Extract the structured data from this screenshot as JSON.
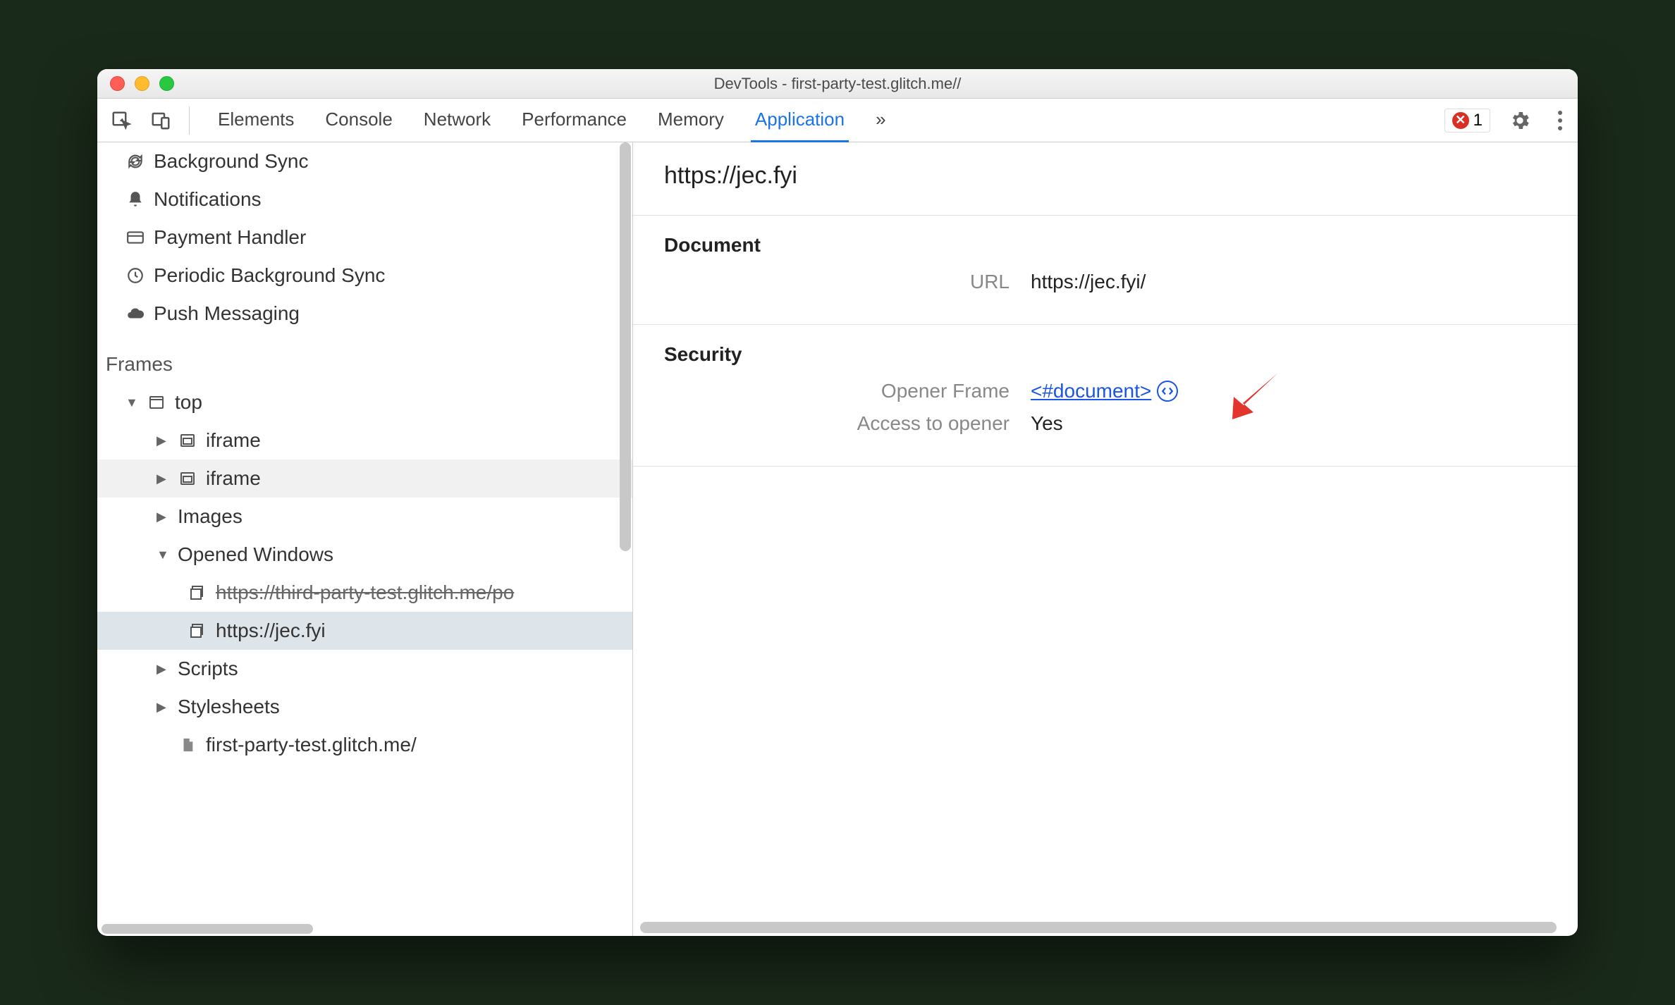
{
  "window": {
    "title": "DevTools - first-party-test.glitch.me//"
  },
  "toolbar": {
    "tabs": [
      "Elements",
      "Console",
      "Network",
      "Performance",
      "Memory",
      "Application"
    ],
    "overflow": "»",
    "active_tab": "Application",
    "error_count": "1"
  },
  "sidebar": {
    "items": [
      {
        "label": "Background Sync",
        "icon": "sync"
      },
      {
        "label": "Notifications",
        "icon": "bell"
      },
      {
        "label": "Payment Handler",
        "icon": "card"
      },
      {
        "label": "Periodic Background Sync",
        "icon": "clock"
      },
      {
        "label": "Push Messaging",
        "icon": "cloud"
      }
    ],
    "frames_label": "Frames",
    "tree": {
      "top": "top",
      "iframe1": "iframe",
      "iframe2": "iframe",
      "images": "Images",
      "opened": "Opened Windows",
      "ow1": "https://third-party-test.glitch.me/po",
      "ow2": "https://jec.fyi",
      "scripts": "Scripts",
      "stylesheets": "Stylesheets",
      "doc": "first-party-test.glitch.me/"
    }
  },
  "main": {
    "title": "https://jec.fyi",
    "document": {
      "heading": "Document",
      "url_label": "URL",
      "url_value": "https://jec.fyi/"
    },
    "security": {
      "heading": "Security",
      "opener_label": "Opener Frame",
      "opener_value": "<#document>",
      "access_label": "Access to opener",
      "access_value": "Yes"
    }
  }
}
